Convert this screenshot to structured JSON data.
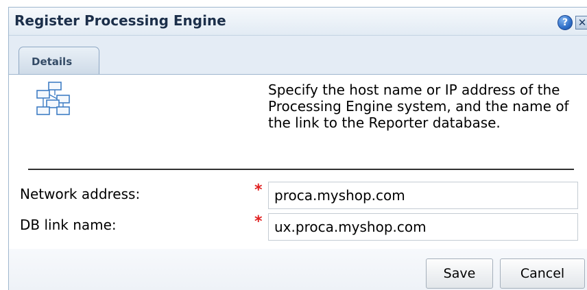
{
  "dialog": {
    "title": "Register Processing Engine",
    "help_glyph": "?",
    "close_glyph": "✕",
    "help_icon": "help-icon",
    "close_icon": "close-icon"
  },
  "tabs": [
    {
      "label": "Details",
      "selected": true
    }
  ],
  "details": {
    "icon": "hierarchy-icon",
    "description": "Specify the host name or IP address of the Processing Engine system, and the name of the link to the Reporter database.",
    "required_marker": "*",
    "fields": [
      {
        "label": "Network address:",
        "value": "proca.myshop.com"
      },
      {
        "label": "DB link name:",
        "value": "ux.proca.myshop.com"
      }
    ]
  },
  "buttons": {
    "save": "Save",
    "cancel": "Cancel"
  },
  "colors": {
    "title_text": "#1c2f4a",
    "required_marker": "#e02020",
    "help_button": "#2f6fc8"
  }
}
